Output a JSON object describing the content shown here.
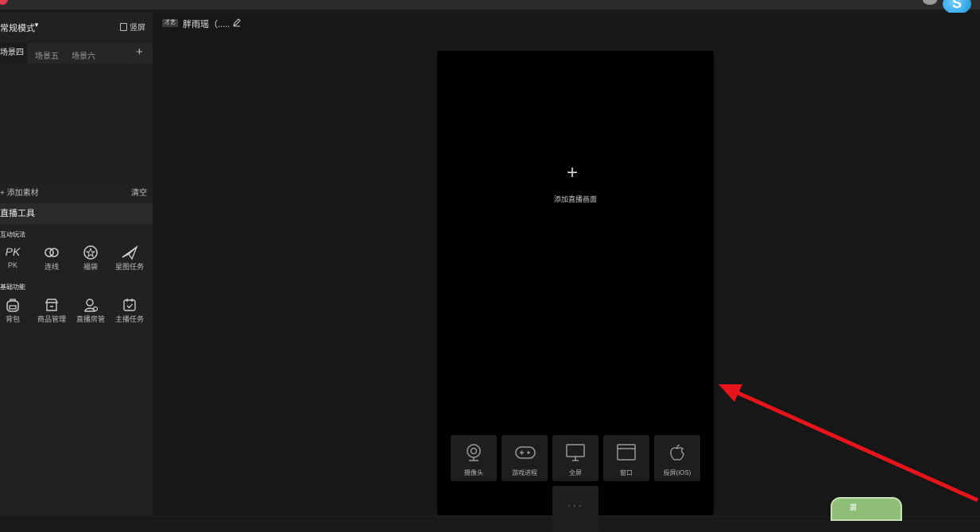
{
  "topbar": {
    "title": "",
    "title2": "",
    "avatar_badge": "S"
  },
  "left": {
    "mode": "常规模式",
    "vertical_screen": "竖屏",
    "scene_tabs": [
      "场景四",
      "场景五",
      "场景六"
    ],
    "add_material": "+ 添加素材",
    "clear": "清空",
    "tools_title": "直播工具",
    "group_interactive": "互动玩法",
    "group_basic": "基础功能",
    "interactive_tools": [
      "PK",
      "连线",
      "福袋",
      "星图任务"
    ],
    "basic_tools": [
      "背包",
      "商品管理",
      "直播房管",
      "主播任务"
    ]
  },
  "main": {
    "anchor_badge": "才艺",
    "anchor_name": "胖雨瑶（.....",
    "add_plus": "+",
    "add_text": "添加直播画面",
    "sources": [
      "摄像头",
      "游戏进程",
      "全屏",
      "窗口",
      "投屏(iOS)"
    ],
    "more": "···",
    "green_tag": "菌"
  },
  "colors": {
    "accent_red": "#e33b4f",
    "arrow_red": "#e8141c",
    "preview_bg": "#000000"
  }
}
